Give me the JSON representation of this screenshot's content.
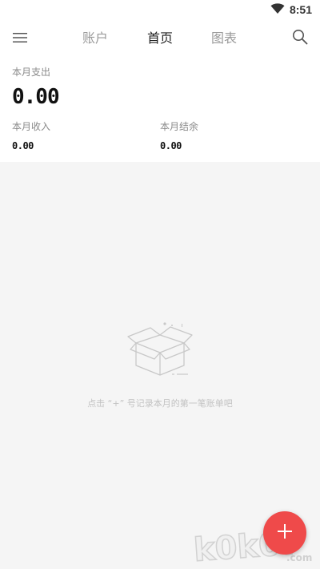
{
  "status_bar": {
    "time": "8:51",
    "icons": [
      "wifi-icon"
    ]
  },
  "header": {
    "tabs": [
      {
        "label": "账户",
        "active": false
      },
      {
        "label": "首页",
        "active": true
      },
      {
        "label": "图表",
        "active": false
      }
    ],
    "left_icon": "menu-icon",
    "right_icon": "search-icon"
  },
  "summary": {
    "expense_label": "本月支出",
    "expense_value": "0.00",
    "income_label": "本月收入",
    "income_value": "0.00",
    "balance_label": "本月结余",
    "balance_value": "0.00"
  },
  "empty_state": {
    "icon": "empty-box-icon",
    "hint": "点击 “+” 号记录本月的第一笔账单吧"
  },
  "fab": {
    "icon": "plus-icon",
    "color": "#ef4a4a"
  },
  "watermark": {
    "text": "k0k07",
    "suffix": ".com"
  },
  "colors": {
    "active_tab": "#1f1f1f",
    "inactive_tab": "#9a9a9a",
    "background": "#f5f5f5",
    "accent": "#ef4a4a"
  }
}
